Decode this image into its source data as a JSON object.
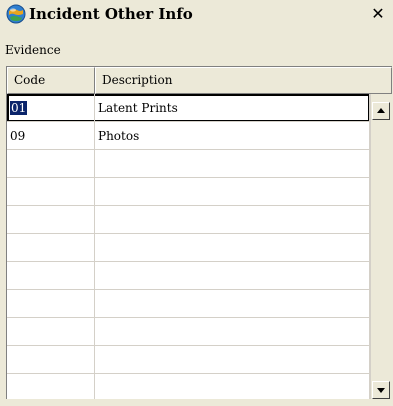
{
  "window": {
    "title": "Incident Other Info",
    "close_symbol": "✕"
  },
  "section": {
    "label": "Evidence"
  },
  "grid": {
    "columns": [
      "Code",
      "Description"
    ],
    "rows": [
      {
        "code": "01",
        "description": "Latent Prints"
      },
      {
        "code": "09",
        "description": "Photos"
      },
      {
        "code": "",
        "description": ""
      },
      {
        "code": "",
        "description": ""
      },
      {
        "code": "",
        "description": ""
      },
      {
        "code": "",
        "description": ""
      },
      {
        "code": "",
        "description": ""
      },
      {
        "code": "",
        "description": ""
      },
      {
        "code": "",
        "description": ""
      },
      {
        "code": "",
        "description": ""
      },
      {
        "code": "",
        "description": ""
      }
    ],
    "current_row": 0
  },
  "icons": {
    "app": "globe-icon",
    "close": "close-icon",
    "scroll_up": "arrow-up-icon",
    "scroll_down": "arrow-down-icon"
  },
  "colors": {
    "window_bg": "#ece9d8",
    "selection_bg": "#0a246a",
    "grid_bg": "#ffffff"
  }
}
